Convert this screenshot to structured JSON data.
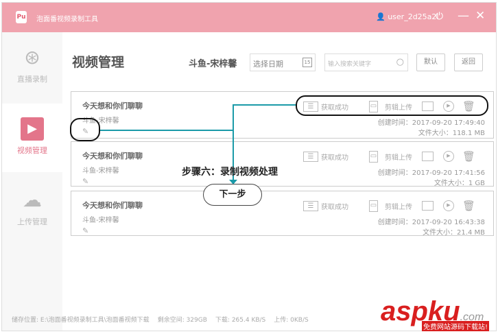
{
  "app": {
    "title": "泡面番视频录制工具",
    "logo": "Pu",
    "user": "user_2d25a2l"
  },
  "sidebar": {
    "items": [
      {
        "label": "直播录制"
      },
      {
        "label": "视频管理"
      },
      {
        "label": "上传管理"
      }
    ]
  },
  "header": {
    "title": "视频管理",
    "streamer": "斗鱼-宋梓馨",
    "date_placeholder": "选择日期",
    "cal": "15",
    "search_placeholder": "输入搜索关键字",
    "default_label": "默认",
    "back_label": "返回"
  },
  "videos": [
    {
      "title": "今天想和你们聊聊",
      "source": "斗鱼-宋梓馨",
      "status": "获取成功",
      "edit_upload": "剪辑上传",
      "created": "创建时间：2017-09-20 17:49:40",
      "size": "文件大小：118.1 MB"
    },
    {
      "title": "今天想和你们聊聊",
      "source": "斗鱼-宋梓馨",
      "status": "获取成功",
      "edit_upload": "剪辑上传",
      "created": "创建时间：2017-09-20 17:41:56",
      "size": "文件大小：1 GB"
    },
    {
      "title": "今天想和你们聊聊",
      "source": "斗鱼-宋梓馨",
      "status": "获取成功",
      "edit_upload": "剪辑上传",
      "created": "创建时间：2017-09-20 16:43:38",
      "size": "文件大小：21.4 MB"
    }
  ],
  "status": {
    "path": "储存位置: E:\\泡面番视频录制工具\\泡面番视频下载",
    "free": "剩余空间: 329GB",
    "down": "下载: 265.4 KB/S",
    "up": "上传: 0KB/S"
  },
  "annotation": {
    "step": "步骤六：录制视频处理",
    "next": "下一步"
  },
  "watermark": {
    "brand": "aspku.com",
    "tag": "免费网站源码下载站!"
  },
  "colors": {
    "titlebar": "#f0a3ae",
    "accent": "#e3758a",
    "arrow": "#1a9aa8"
  }
}
